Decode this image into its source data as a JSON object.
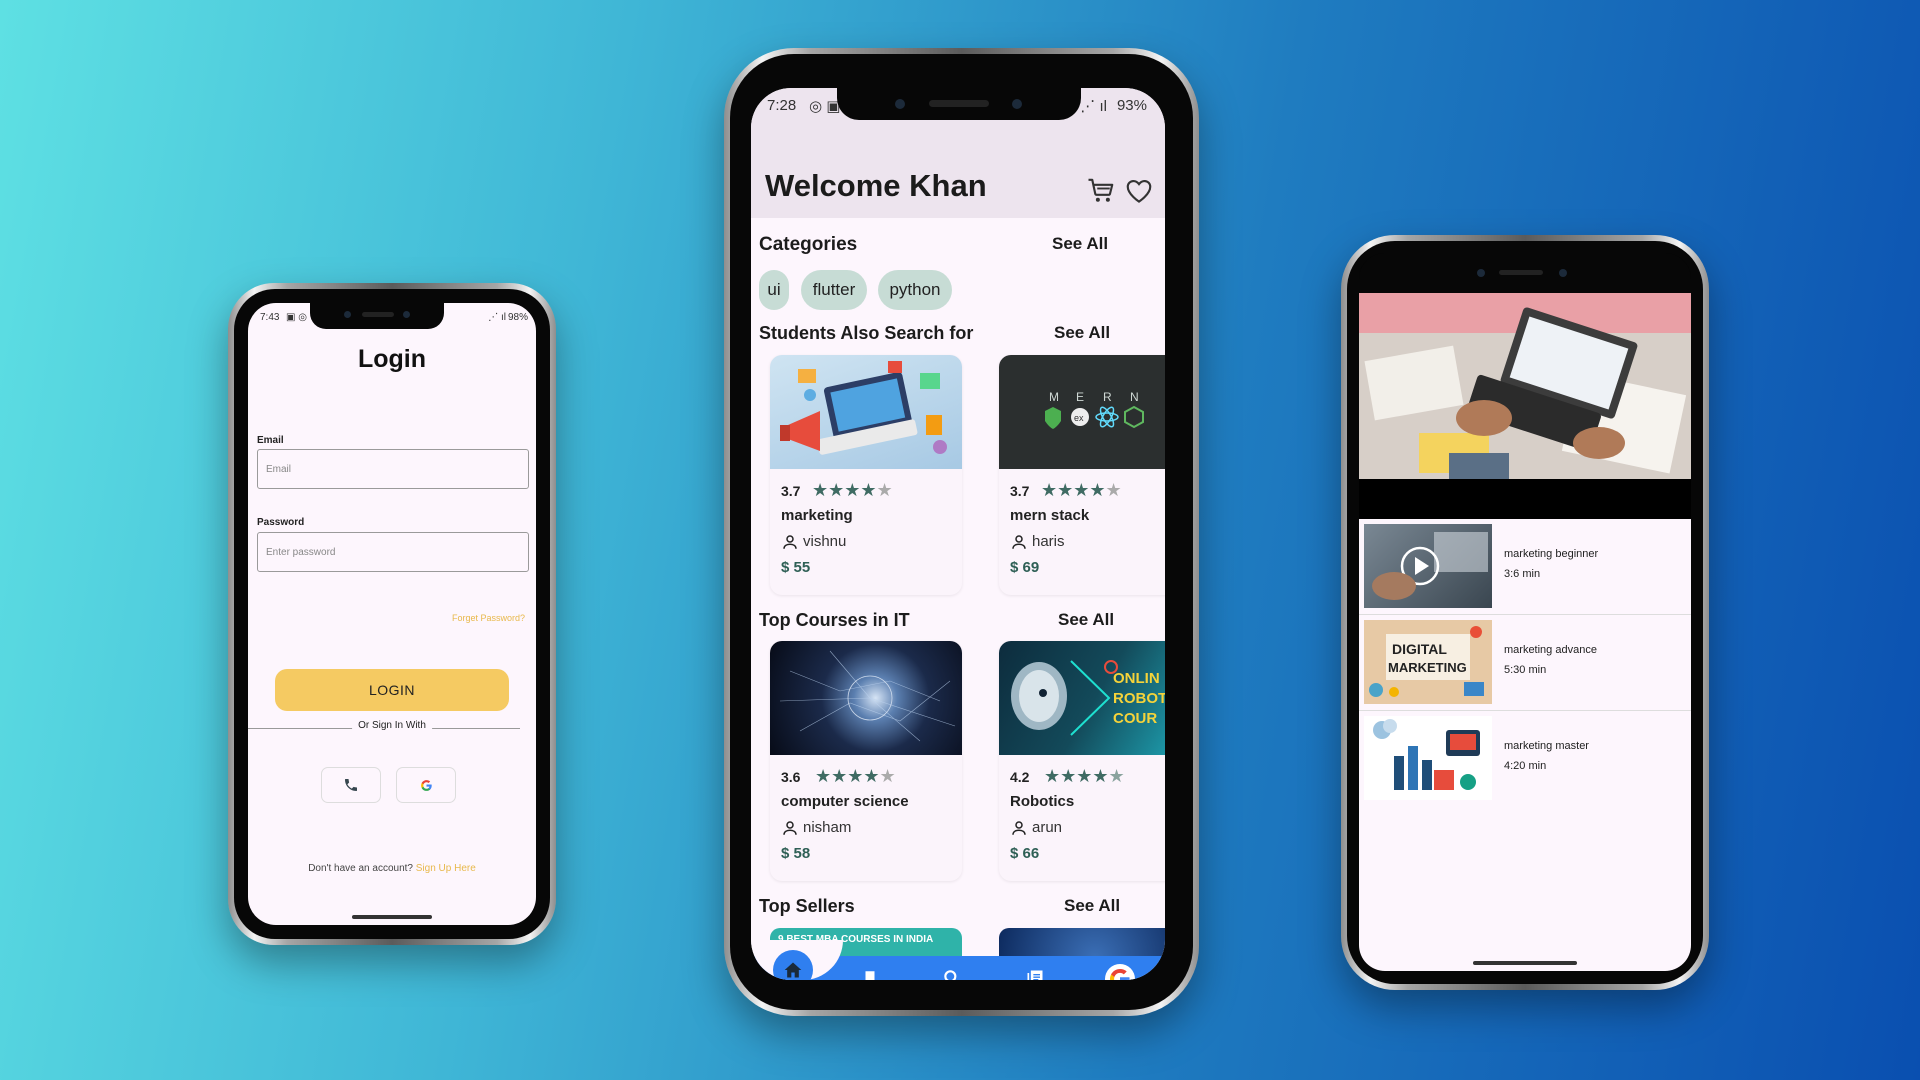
{
  "login_screen": {
    "status_time": "7:43",
    "status_battery": "98%",
    "title": "Login",
    "email_label": "Email",
    "email_placeholder": "Email",
    "password_label": "Password",
    "password_placeholder": "Enter password",
    "forgot_password": "Forget Password?",
    "login_button": "LOGIN",
    "or_sign_in_with": "Or Sign In With",
    "no_account_text": "Don't have an account?",
    "sign_up_link": "Sign Up Here"
  },
  "home_screen": {
    "status_time": "7:28",
    "status_battery": "93%",
    "welcome": "Welcome Khan",
    "categories_title": "Categories",
    "see_all": "See All",
    "chips": [
      "ui",
      "flutter",
      "python"
    ],
    "students_title": "Students Also Search for",
    "top_it_title": "Top Courses in IT",
    "top_sellers_title": "Top Sellers",
    "students_cards": [
      {
        "rating": "3.7",
        "stars": 4,
        "name": "marketing",
        "author": "vishnu",
        "price": "$ 55"
      },
      {
        "rating": "3.7",
        "stars": 4,
        "name": "mern stack",
        "author": "haris",
        "price": "$ 69"
      }
    ],
    "it_cards": [
      {
        "rating": "3.6",
        "stars": 4,
        "name": "computer science",
        "author": "nisham",
        "price": "$ 58"
      },
      {
        "rating": "4.2",
        "stars": 4.5,
        "name": "Robotics",
        "author": "arun",
        "price": "$ 66"
      }
    ],
    "mern_letters": [
      "M",
      "E",
      "R",
      "N"
    ],
    "robotics_banner": [
      "ONLIN",
      "ROBOT",
      "COUR"
    ],
    "seller_banner": "9 BEST MBA COURSES IN INDIA",
    "colors": {
      "nav_blue": "#2f7ff0",
      "chip": "#c7dcd5",
      "price": "#2e5f55"
    }
  },
  "course_screen": {
    "lessons": [
      {
        "title": "marketing beginner",
        "duration": "3:6 min"
      },
      {
        "title": "marketing advance",
        "duration": "5:30  min"
      },
      {
        "title": "marketing master",
        "duration": "4:20 min"
      }
    ],
    "thumb_text": "DIGITAL MARKETING"
  }
}
